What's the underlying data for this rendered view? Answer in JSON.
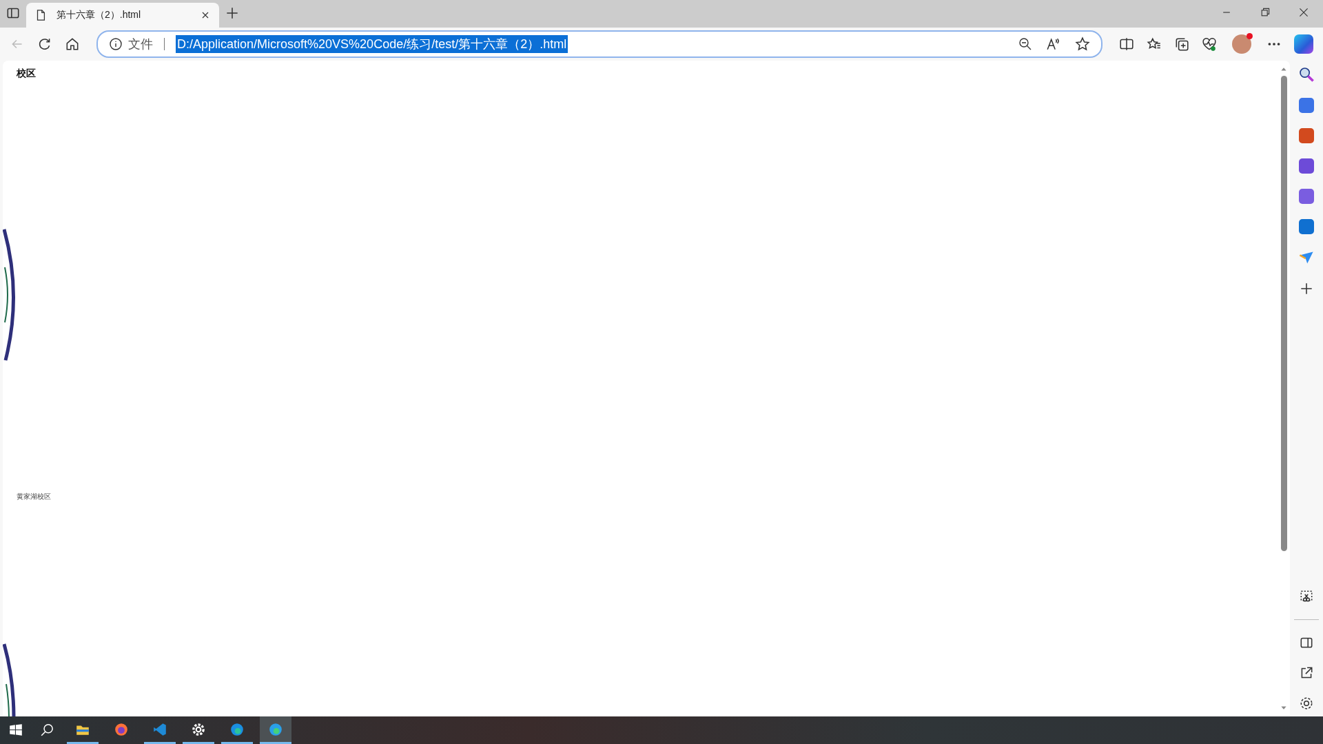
{
  "tabs": [
    {
      "title": "第十六章（2）.html",
      "selected": true
    }
  ],
  "address_bar": {
    "scheme_label": "文件",
    "url": "D:/Application/Microsoft%20VS%20Code/练习/test/第十六章（2）.html",
    "url_selected": true
  },
  "page": {
    "heading": "校区",
    "label": "黄家湖校区"
  },
  "taskbar": {
    "apps": [
      {
        "kind": "explorer",
        "running": true,
        "selected": false
      },
      {
        "kind": "firefox",
        "running": false,
        "selected": false
      },
      {
        "kind": "vscode",
        "running": true,
        "selected": false
      },
      {
        "kind": "settings",
        "running": true,
        "selected": false
      },
      {
        "kind": "edge",
        "running": true,
        "selected": false
      },
      {
        "kind": "edge-alt",
        "running": true,
        "selected": true
      }
    ]
  }
}
